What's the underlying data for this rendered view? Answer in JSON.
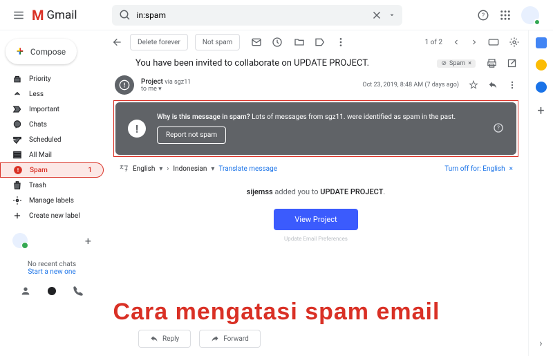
{
  "header": {
    "brand": "Gmail",
    "search_value": "in:spam"
  },
  "compose_label": "Compose",
  "sidebar": {
    "items": [
      {
        "label": "Priority",
        "icon": "priority"
      },
      {
        "label": "Less",
        "icon": "less"
      },
      {
        "label": "Important",
        "icon": "important"
      },
      {
        "label": "Chats",
        "icon": "chats"
      },
      {
        "label": "Scheduled",
        "icon": "scheduled"
      },
      {
        "label": "All Mail",
        "icon": "allmail"
      },
      {
        "label": "Spam",
        "icon": "spam",
        "count": "1",
        "active": true
      },
      {
        "label": "Trash",
        "icon": "trash"
      },
      {
        "label": "Manage labels",
        "icon": "manage"
      },
      {
        "label": "Create new label",
        "icon": "create"
      }
    ],
    "chat_empty": "No recent chats",
    "chat_start": "Start a new one"
  },
  "toolbar": {
    "delete_forever": "Delete forever",
    "not_spam": "Not spam",
    "counter": "1 of 2"
  },
  "subject": "You have been invited to collaborate on  UPDATE PROJECT.",
  "spam_chip": "Spam",
  "sender": {
    "name": "Project",
    "via": "via sgz11",
    "to": "to me",
    "date": "Oct 23, 2019, 8:48 AM (7 days ago)"
  },
  "spam_banner": {
    "question": "Why is this message in spam?",
    "reason": "Lots of messages from sgz11. were identified as spam in the past.",
    "button": "Report not spam"
  },
  "translate": {
    "from": "English",
    "to": "Indonesian",
    "action": "Translate message",
    "turnoff": "Turn off for: English"
  },
  "body": {
    "inviter": "sijemss",
    "added": " added you to  ",
    "project": "UPDATE PROJECT",
    "view_btn": "View Project",
    "pref": "Update Email Preferences"
  },
  "reply": {
    "reply": "Reply",
    "forward": "Forward"
  },
  "overlay": "Cara mengatasi spam email"
}
